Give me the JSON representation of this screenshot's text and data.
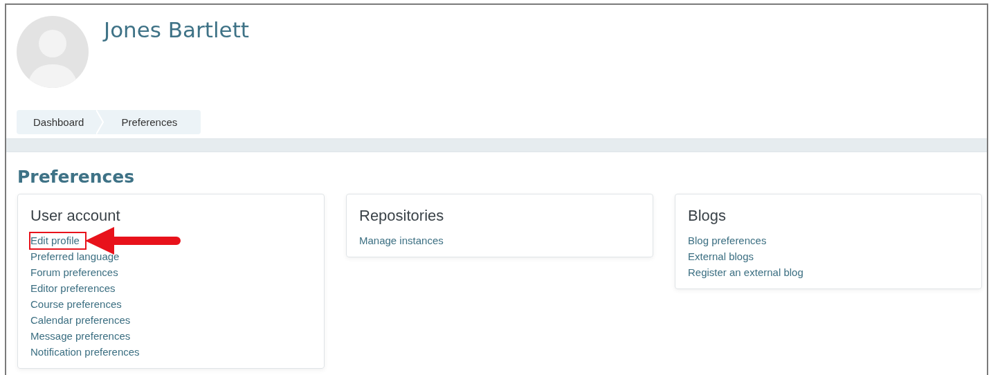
{
  "user": {
    "name": "Jones Bartlett"
  },
  "breadcrumb": [
    {
      "label": "Dashboard"
    },
    {
      "label": "Preferences"
    }
  ],
  "page_title": "Preferences",
  "cards": [
    {
      "title": "User account",
      "links": [
        {
          "label": "Edit profile",
          "highlighted": true
        },
        {
          "label": "Preferred language",
          "highlighted": false
        },
        {
          "label": "Forum preferences",
          "highlighted": false
        },
        {
          "label": "Editor preferences",
          "highlighted": false
        },
        {
          "label": "Course preferences",
          "highlighted": false
        },
        {
          "label": "Calendar preferences",
          "highlighted": false
        },
        {
          "label": "Message preferences",
          "highlighted": false
        },
        {
          "label": "Notification preferences",
          "highlighted": false
        }
      ]
    },
    {
      "title": "Repositories",
      "links": [
        {
          "label": "Manage instances",
          "highlighted": false
        }
      ]
    },
    {
      "title": "Blogs",
      "links": [
        {
          "label": "Blog preferences",
          "highlighted": false
        },
        {
          "label": "External blogs",
          "highlighted": false
        },
        {
          "label": "Register an external blog",
          "highlighted": false
        }
      ]
    }
  ]
}
